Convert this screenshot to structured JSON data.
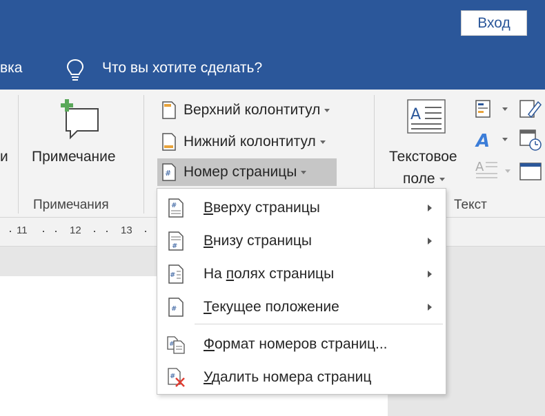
{
  "titlebar": {
    "signin_label": "Вход"
  },
  "tabs": {
    "partial_tab": "вка",
    "tellme": "Что вы хотите сделать?"
  },
  "ribbon": {
    "partial_left": "и",
    "comment_button": "Примечание",
    "comments_group": "Примечания",
    "header_button": "Верхний колонтитул",
    "footer_button": "Нижний колонтитул",
    "page_number_button": "Номер страницы",
    "textbox_line1": "Текстовое",
    "textbox_line2": "поле",
    "text_group": "Текст"
  },
  "ruler": {
    "numbers": [
      "11",
      "12",
      "13"
    ]
  },
  "menu": {
    "items": [
      {
        "label_first": "В",
        "label_rest": "верху страницы",
        "submenu": true,
        "icon": "page-number-top-icon"
      },
      {
        "label_first": "В",
        "label_rest": "низу страницы",
        "submenu": true,
        "icon": "page-number-bottom-icon"
      },
      {
        "label_pre": "На ",
        "label_first": "п",
        "label_rest": "олях страницы",
        "submenu": true,
        "icon": "page-margins-icon"
      },
      {
        "label_first": "Т",
        "label_rest": "екущее положение",
        "submenu": true,
        "icon": "current-position-icon"
      },
      {
        "label_first": "Ф",
        "label_rest": "ормат номеров страниц...",
        "submenu": false,
        "icon": "format-page-numbers-icon"
      },
      {
        "label_first": "У",
        "label_rest": "далить номера страниц",
        "submenu": false,
        "icon": "remove-page-numbers-icon"
      }
    ]
  },
  "colors": {
    "accent": "#2b579a",
    "ribbon_bg": "#f3f3f3",
    "active_button": "#c6c6c6",
    "remove_red": "#e03c31",
    "comment_green": "#5aa85a"
  }
}
